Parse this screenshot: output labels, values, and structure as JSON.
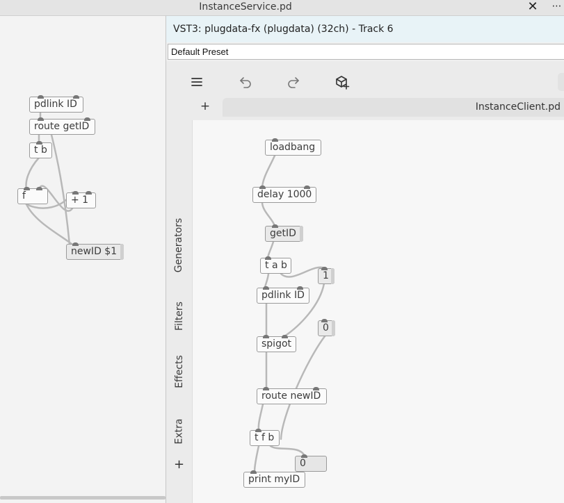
{
  "background_window": {
    "title": "InstanceService.pd",
    "close_icon": "close-icon",
    "more_icon": "more-icon",
    "more_label": "⋯"
  },
  "background_patch": {
    "objects": [
      {
        "id": "pdlink",
        "text": "pdlink ID"
      },
      {
        "id": "route",
        "text": "route getID"
      },
      {
        "id": "tb",
        "text": "t b"
      },
      {
        "id": "f",
        "text": "f"
      },
      {
        "id": "plus1",
        "text": "+ 1"
      },
      {
        "id": "newid",
        "text": "newID $1"
      }
    ]
  },
  "plugin_window": {
    "title": "VST3: plugdata-fx (plugdata) (32ch) - Track 6",
    "preset": "Default Preset",
    "toolbar": {
      "menu_icon": "menu-icon",
      "undo_icon": "undo-icon",
      "redo_icon": "redo-icon",
      "add_object_icon": "add-object-icon"
    },
    "tab_add_label": "+",
    "tab_label": "InstanceClient.pd",
    "sidebar": {
      "tabs": [
        "Generators",
        "Filters",
        "Effects",
        "Extra"
      ],
      "add_label": "+"
    }
  },
  "client_patch": {
    "objects": [
      {
        "id": "loadbang",
        "text": "loadbang"
      },
      {
        "id": "delay",
        "text": "delay 1000"
      },
      {
        "id": "getid",
        "text": "getID"
      },
      {
        "id": "tab",
        "text": "t a b"
      },
      {
        "id": "num1",
        "text": "1"
      },
      {
        "id": "pdlink",
        "text": "pdlink ID"
      },
      {
        "id": "num0",
        "text": "0"
      },
      {
        "id": "spigot",
        "text": "spigot"
      },
      {
        "id": "routenew",
        "text": "route newID"
      },
      {
        "id": "tfb",
        "text": "t f b"
      },
      {
        "id": "numbox",
        "text": "0"
      },
      {
        "id": "print",
        "text": "print myID"
      }
    ]
  }
}
